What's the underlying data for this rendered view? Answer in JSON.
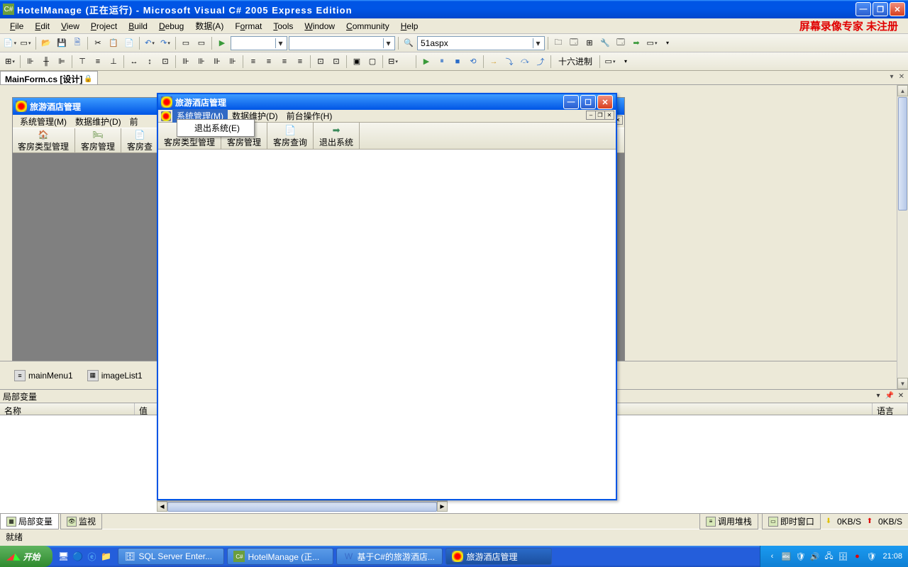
{
  "titlebar": {
    "title": "HotelManage (正在运行) - Microsoft Visual C# 2005 Express Edition"
  },
  "watermark": "屏幕录像专家 未注册",
  "menus": {
    "file": "File",
    "edit": "Edit",
    "view": "View",
    "project": "Project",
    "build": "Build",
    "debug": "Debug",
    "data": "数据(A)",
    "format": "Format",
    "tools": "Tools",
    "window": "Window",
    "community": "Community",
    "help": "Help"
  },
  "toolbar": {
    "debug_combo": "",
    "target_combo": "",
    "find_combo": "51aspx",
    "hex_label": "十六进制"
  },
  "doc_tab": {
    "name": "MainForm.cs [设计]"
  },
  "design_window": {
    "title": "旅游酒店管理",
    "menus": {
      "m1": "系统管理(M)",
      "m2": "数据维护(D)",
      "m3": "前"
    },
    "tbtns": {
      "b1": "客房类型管理",
      "b2": "客房管理",
      "b3": "客房查"
    }
  },
  "components": {
    "c1": "mainMenu1",
    "c2": "imageList1"
  },
  "locals_panel": {
    "title": "局部变量",
    "col_name": "名称",
    "col_value": "值",
    "col_lang": "语言"
  },
  "bottom_tabs": {
    "t1": "局部变量",
    "t2": "监视",
    "t3": "调用堆栈",
    "t4": "即时窗口"
  },
  "status": {
    "ready": "就绪"
  },
  "netspeed": {
    "down": "0KB/S",
    "up": "0KB/S"
  },
  "run_window": {
    "title": "旅游酒店管理",
    "menus": {
      "m1": "系统管理(M)",
      "m2": "数据维护(D)",
      "m3": "前台操作(H)"
    },
    "dropdown": {
      "i1": "退出系统(E)"
    },
    "tbtns": {
      "b1": "客房类型管理",
      "b2": "客房管理",
      "b3": "客房查询",
      "b4": "退出系统"
    }
  },
  "taskbar": {
    "start": "开始",
    "btns": {
      "b1": "SQL Server Enter...",
      "b2": "HotelManage (正...",
      "b3": "基于C#的旅游酒店...",
      "b4": "旅游酒店管理"
    },
    "clock": "21:08"
  }
}
